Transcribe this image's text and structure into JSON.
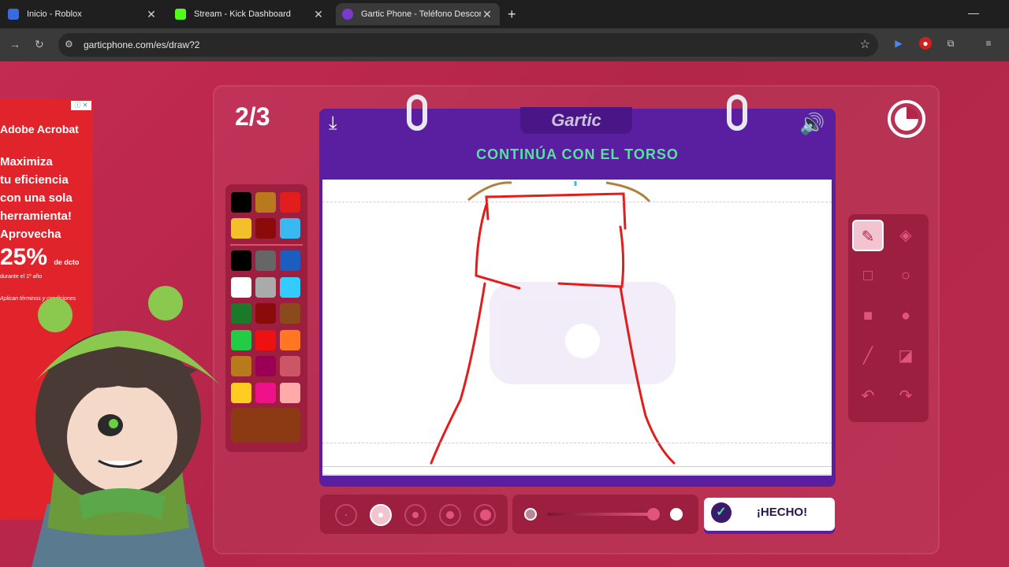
{
  "browser": {
    "tabs": [
      {
        "title": "Inicio - Roblox",
        "active": false
      },
      {
        "title": "Stream - Kick Dashboard",
        "active": false
      },
      {
        "title": "Gartic Phone - Teléfono Descon",
        "active": true
      }
    ],
    "url": "garticphone.com/es/draw?2"
  },
  "game": {
    "round": "2/3",
    "logo": "Gartic",
    "prompt": "CONTINÚA CON EL TORSO",
    "done_label": "¡HECHO!",
    "current_color": "#8b3a14"
  },
  "palette": {
    "top_row": [
      "#000000",
      "#b87a1c",
      "#e31c1c",
      "#f4c02a",
      "#8b0a0a",
      "#3ab8f0"
    ],
    "grid": [
      "#000000",
      "#666666",
      "#1a5fc0",
      "#ffffff",
      "#aaaaaa",
      "#33ccff",
      "#1a7a2a",
      "#8b0a0a",
      "#8b4a1a",
      "#22cc44",
      "#ee1111",
      "#ff7722",
      "#b87a1c",
      "#990055",
      "#cc5566",
      "#ffcc22",
      "#ee1188",
      "#ffaaaa"
    ]
  },
  "tools": [
    "pencil-icon",
    "eraser-icon",
    "square-outline-icon",
    "circle-outline-icon",
    "square-filled-icon",
    "circle-filled-icon",
    "line-icon",
    "fill-bucket-icon",
    "undo-icon",
    "redo-icon"
  ],
  "brush": {
    "selected_size_index": 1
  },
  "ad": {
    "brand": "Adobe Acrobat",
    "lines": [
      "Maximiza",
      "tu eficiencia",
      "con una sola",
      "herramienta!",
      "Aprovecha"
    ],
    "discount": "25%",
    "discount_suffix": "de dcto",
    "sub": "durante el 1º año",
    "note": "Aplican términos y condiciones"
  }
}
